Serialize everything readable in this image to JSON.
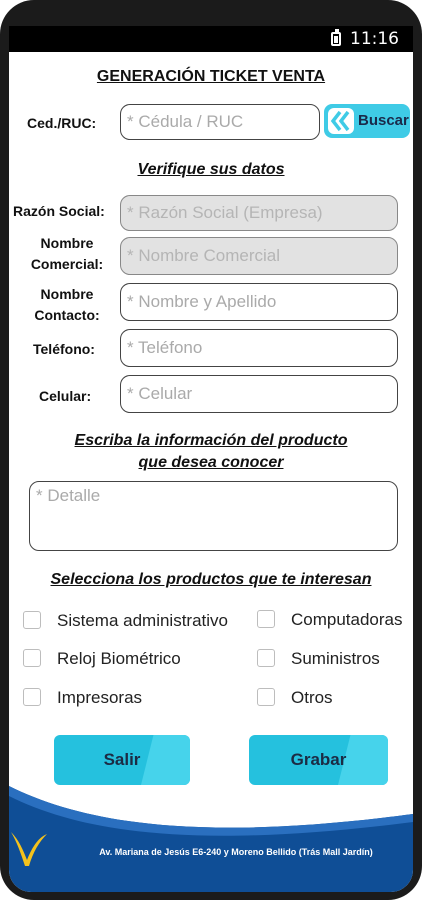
{
  "status_bar": {
    "time": "11:16",
    "battery_icon": "battery-icon"
  },
  "form": {
    "title": "GENERACIÓN TICKET VENTA",
    "ced_label": "Ced./RUC:",
    "ced_placeholder": "* Cédula / RUC",
    "buscar_label": "Buscar",
    "verify_title": "Verifique sus datos",
    "razon_label": "Razón Social:",
    "razon_placeholder": "* Razón Social (Empresa)",
    "nombre_comercial_label_1": "Nombre",
    "nombre_comercial_label_2": "Comercial:",
    "nombre_comercial_placeholder": "* Nombre Comercial",
    "nombre_contacto_label_1": "Nombre",
    "nombre_contacto_label_2": "Contacto:",
    "nombre_contacto_placeholder": "* Nombre y Apellido",
    "telefono_label": "Teléfono:",
    "telefono_placeholder": "* Teléfono",
    "celular_label": "Celular:",
    "celular_placeholder": "* Celular",
    "info_title_1": "Escriba la información del producto",
    "info_title_2": "que desea conocer",
    "detalle_placeholder": "* Detalle",
    "products_title": "Selecciona los productos que te interesan",
    "products": [
      {
        "label": "Sistema administrativo",
        "checked": false
      },
      {
        "label": "Computadoras",
        "checked": false
      },
      {
        "label": "Reloj Biométrico",
        "checked": false
      },
      {
        "label": "Suministros",
        "checked": false
      },
      {
        "label": "Impresoras",
        "checked": false
      },
      {
        "label": "Otros",
        "checked": false
      }
    ],
    "salir_label": "Salir",
    "grabar_label": "Grabar"
  },
  "footer": {
    "address": "Av. Mariana de Jesús E6-240 y Moreno Bellido (Trás Mall Jardín)",
    "logo_icon": "brand-logo-icon"
  },
  "colors": {
    "accent": "#3fcbe6",
    "footer_blue": "#0f4e96",
    "frame": "#1b1b1b"
  }
}
